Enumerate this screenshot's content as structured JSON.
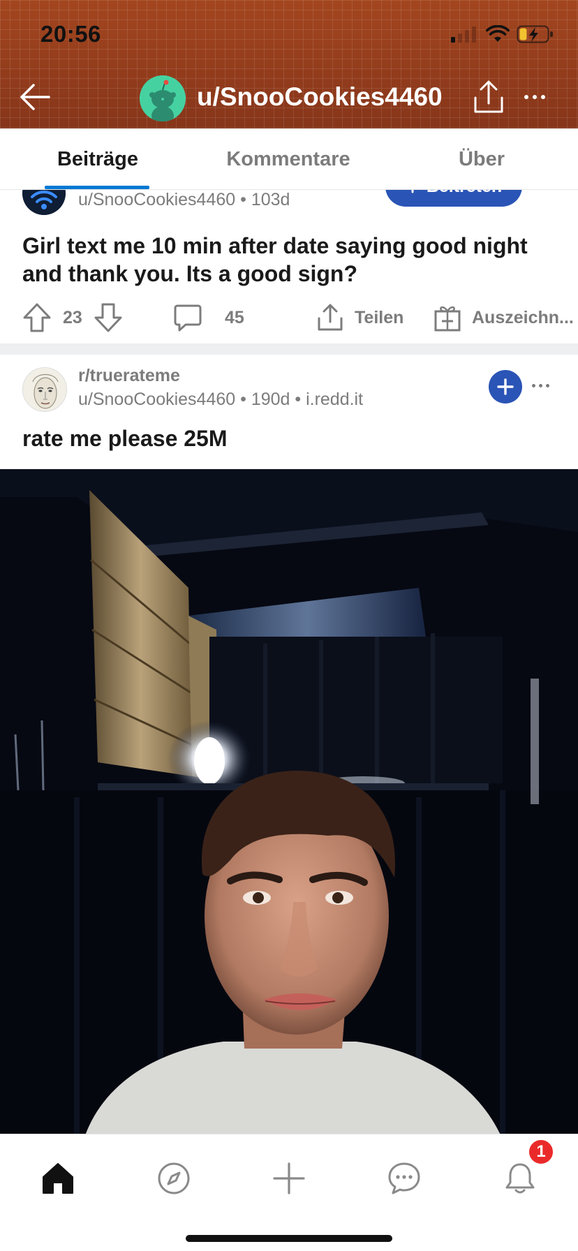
{
  "status_bar": {
    "time": "20:56"
  },
  "header": {
    "title": "u/SnooCookies4460"
  },
  "tabs": [
    {
      "label": "Beiträge",
      "active": true
    },
    {
      "label": "Kommentare",
      "active": false
    },
    {
      "label": "Über",
      "active": false
    }
  ],
  "posts": [
    {
      "meta": "u/SnooCookies4460 • 103d",
      "join_label": "Beitreten",
      "title": "Girl text me 10 min after date saying good night and thank you. Its a good sign?",
      "upvotes": "23",
      "comments": "45",
      "share_label": "Teilen",
      "award_label": "Auszeichn..."
    },
    {
      "subreddit": "r/truerateme",
      "meta": "u/SnooCookies4460 • 190d • i.redd.it",
      "title": "rate me please 25M"
    }
  ],
  "bottom_nav": {
    "items": [
      "home-icon",
      "explore-icon",
      "create-icon",
      "chat-icon",
      "notifications-icon"
    ],
    "notification_count": "1"
  },
  "colors": {
    "header_bg": "#8e3a1c",
    "accent_blue": "#2a54b6",
    "tab_indicator": "#0079d3",
    "badge_red": "#ea2a2a"
  }
}
